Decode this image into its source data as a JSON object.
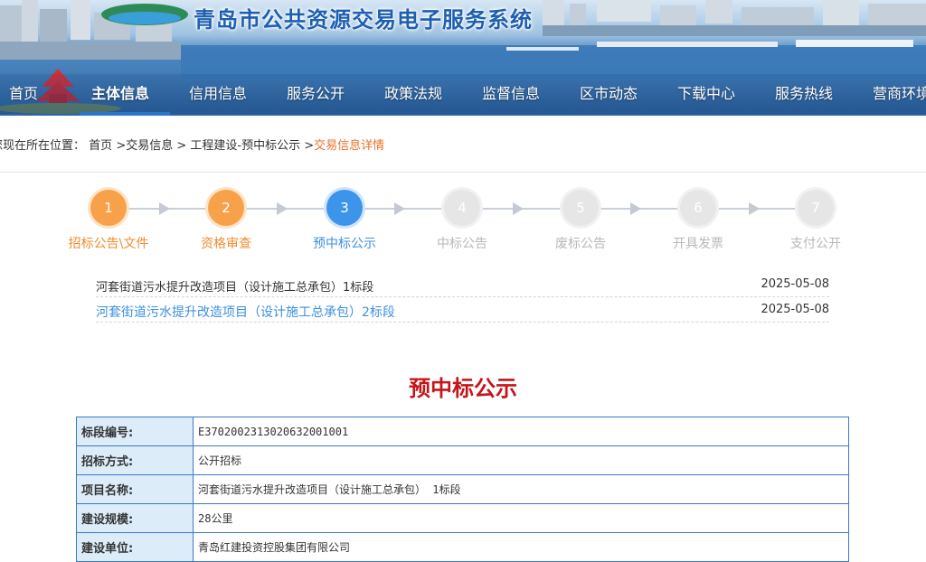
{
  "header": {
    "site_title": "青岛市公共资源交易电子服务系统",
    "nav": [
      {
        "label": "首页"
      },
      {
        "label": "主体信息",
        "active": true
      },
      {
        "label": "信用信息"
      },
      {
        "label": "服务公开"
      },
      {
        "label": "政策法规"
      },
      {
        "label": "监督信息"
      },
      {
        "label": "区市动态"
      },
      {
        "label": "下载中心"
      },
      {
        "label": "服务热线"
      },
      {
        "label": "营商环境"
      }
    ]
  },
  "breadcrumb": {
    "prefix": "您现在所在位置：",
    "items": [
      "首页",
      ">交易信息",
      ">",
      "工程建设-预中标公示",
      ">"
    ],
    "current": "交易信息详情"
  },
  "steps": [
    {
      "number": "1",
      "label": "招标公告\\文件",
      "state": "done"
    },
    {
      "number": "2",
      "label": "资格审查",
      "state": "done"
    },
    {
      "number": "3",
      "label": "预中标公示",
      "state": "current"
    },
    {
      "number": "4",
      "label": "中标公告",
      "state": "pending"
    },
    {
      "number": "5",
      "label": "废标公告",
      "state": "pending"
    },
    {
      "number": "6",
      "label": "开具发票",
      "state": "pending"
    },
    {
      "number": "7",
      "label": "支付公开",
      "state": "pending"
    }
  ],
  "sections": [
    {
      "title": "河套街道污水提升改造项目（设计施工总承包）1标段",
      "date": "2025-05-08",
      "active": false
    },
    {
      "title": "河套街道污水提升改造项目（设计施工总承包）2标段",
      "date": "2025-05-08",
      "active": true
    }
  ],
  "page_heading": "预中标公示",
  "detail_rows": [
    {
      "label": "标段编号:",
      "value": "E3702002313020632001001"
    },
    {
      "label": "招标方式:",
      "value": "公开招标"
    },
    {
      "label": "项目名称:",
      "value": "河套街道污水提升改造项目（设计施工总承包） 1标段"
    },
    {
      "label": "建设规模:",
      "value": "28公里"
    },
    {
      "label": "建设单位:",
      "value": "青岛红建投资控股集团有限公司"
    }
  ]
}
